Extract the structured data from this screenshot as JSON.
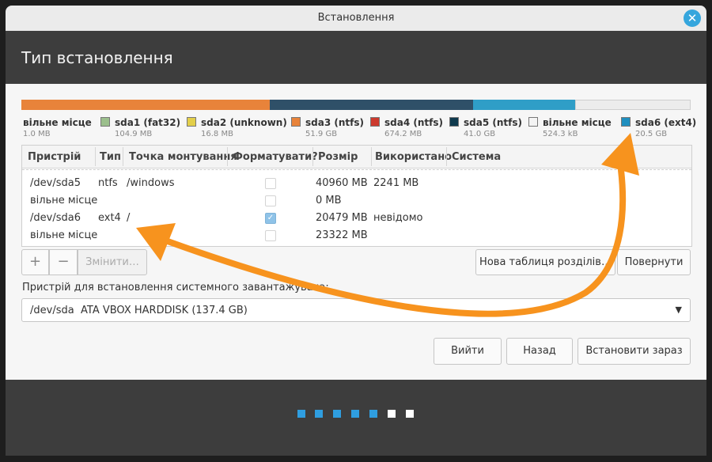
{
  "window": {
    "title": "Встановлення",
    "close_glyph": "✕",
    "heading": "Тип встановлення"
  },
  "partition_bar": {
    "segments": [
      {
        "name": "вільне місце (left edge)",
        "color": "#e8833a",
        "fraction": 0.372
      },
      {
        "name": "sda4",
        "color": "#2f5068",
        "fraction": 0.306
      },
      {
        "name": "sda5",
        "color": "#2f9ec7",
        "fraction": 0.152
      },
      {
        "name": "вільне місце",
        "color": "#ececec",
        "fraction": 0.17
      }
    ]
  },
  "legend": [
    {
      "label": "вільне місце",
      "size": "1.0 MB",
      "color": null
    },
    {
      "label": "sda1 (fat32)",
      "size": "104.9 MB",
      "color": "#9bbf8c"
    },
    {
      "label": "sda2 (unknown)",
      "size": "16.8 MB",
      "color": "#e3cf4a"
    },
    {
      "label": "sda3 (ntfs)",
      "size": "51.9 GB",
      "color": "#e8833a"
    },
    {
      "label": "sda4 (ntfs)",
      "size": "674.2 MB",
      "color": "#cc3a2e"
    },
    {
      "label": "sda5 (ntfs)",
      "size": "41.0 GB",
      "color": "#0f3a4e"
    },
    {
      "label": "вільне місце",
      "size": "524.3 kB",
      "color": "#f4f4f4"
    },
    {
      "label": "sda6 (ext4)",
      "size": "20.5 GB",
      "color": "#1f8fbf"
    }
  ],
  "table": {
    "headers": [
      "Пристрій",
      "Тип",
      "Точка монтування",
      "Форматувати?",
      "Розмір",
      "Використано",
      "Система"
    ],
    "rows": [
      {
        "device": "/dev/sda5",
        "type": "ntfs",
        "mount": "/windows",
        "format": false,
        "size": "40960 MB",
        "used": "2241 MB",
        "system": ""
      },
      {
        "device": "вільне місце",
        "type": "",
        "mount": "",
        "format": false,
        "size": "0 MB",
        "used": "",
        "system": ""
      },
      {
        "device": "/dev/sda6",
        "type": "ext4",
        "mount": "/",
        "format": true,
        "size": "20479 MB",
        "used": "невідомо",
        "system": ""
      },
      {
        "device": "вільне місце",
        "type": "",
        "mount": "",
        "format": false,
        "size": "23322 MB",
        "used": "",
        "system": ""
      }
    ]
  },
  "controls": {
    "add": "+",
    "remove": "−",
    "change": "Змінити…",
    "new_table": "Нова таблиця розділів…",
    "revert": "Повернути"
  },
  "bootloader": {
    "label": "Пристрій для встановлення системного завантажувача:",
    "device": "/dev/sda",
    "description": "ATA VBOX HARDDISK (137.4 GB)",
    "arrow": "▼"
  },
  "nav": {
    "quit": "Вийти",
    "back": "Назад",
    "install": "Встановити зараз"
  },
  "progress": {
    "total_steps": 7,
    "completed_steps": 5
  },
  "colors": {
    "accent": "#2f9ee0",
    "annotation_arrow": "#f7931e"
  }
}
